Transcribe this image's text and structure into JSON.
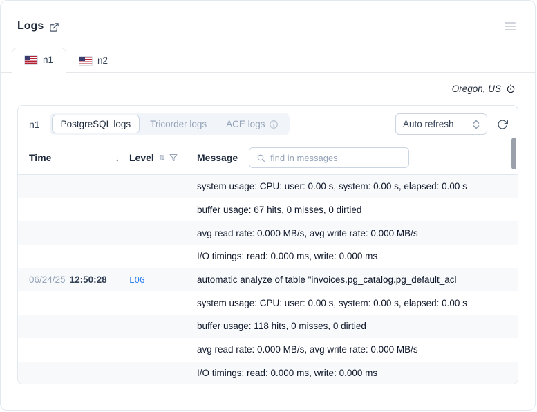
{
  "header": {
    "title": "Logs"
  },
  "tabs": [
    {
      "label": "n1",
      "flag": "us-flag",
      "active": true
    },
    {
      "label": "n2",
      "flag": "us-flag",
      "active": false
    }
  ],
  "region": {
    "label": "Oregon, US"
  },
  "panel": {
    "node_label": "n1",
    "log_tabs": [
      {
        "label": "PostgreSQL logs",
        "active": true
      },
      {
        "label": "Tricorder logs",
        "active": false
      },
      {
        "label": "ACE logs",
        "active": false,
        "has_info_icon": true
      }
    ],
    "auto_refresh_label": "Auto refresh"
  },
  "icons": {
    "sort_desc": "↓",
    "sort_both": "⇅"
  },
  "colors": {
    "level_log": "#2f80ed",
    "border": "#e2e8f0",
    "muted": "#94a3b8"
  },
  "table": {
    "columns": [
      "Time",
      "Level",
      "Message"
    ],
    "search_placeholder": "find in messages",
    "rows": [
      {
        "date": "",
        "time": "",
        "level": "",
        "message": "system usage: CPU: user: 0.00 s, system: 0.00 s, elapsed: 0.00 s"
      },
      {
        "date": "",
        "time": "",
        "level": "",
        "message": "buffer usage: 67 hits, 0 misses, 0 dirtied"
      },
      {
        "date": "",
        "time": "",
        "level": "",
        "message": "avg read rate: 0.000 MB/s, avg write rate: 0.000 MB/s"
      },
      {
        "date": "",
        "time": "",
        "level": "",
        "message": "I/O timings: read: 0.000 ms, write: 0.000 ms"
      },
      {
        "date": "06/24/25",
        "time": "12:50:28",
        "level": "LOG",
        "message": "automatic analyze of table \"invoices.pg_catalog.pg_default_acl"
      },
      {
        "date": "",
        "time": "",
        "level": "",
        "message": "system usage: CPU: user: 0.00 s, system: 0.00 s, elapsed: 0.00 s"
      },
      {
        "date": "",
        "time": "",
        "level": "",
        "message": "buffer usage: 118 hits, 0 misses, 0 dirtied"
      },
      {
        "date": "",
        "time": "",
        "level": "",
        "message": "avg read rate: 0.000 MB/s, avg write rate: 0.000 MB/s"
      },
      {
        "date": "",
        "time": "",
        "level": "",
        "message": "I/O timings: read: 0.000 ms, write: 0.000 ms"
      }
    ]
  }
}
